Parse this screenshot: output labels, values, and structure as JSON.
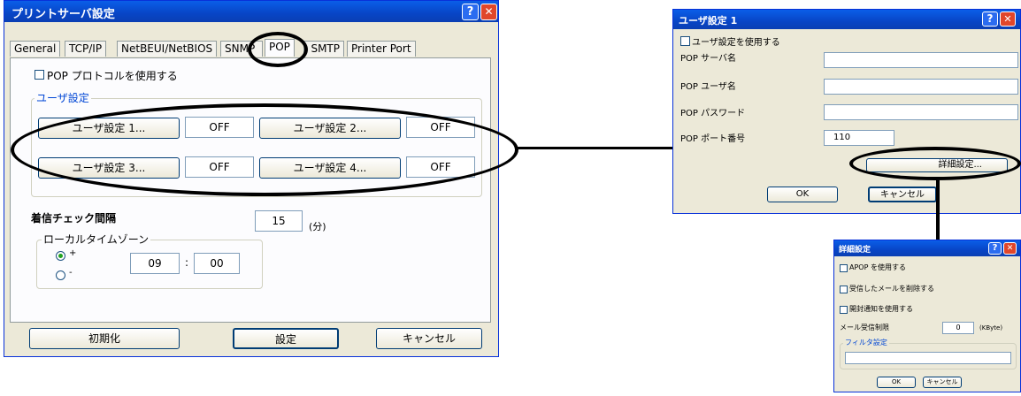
{
  "main": {
    "title": "プリントサーバ設定",
    "help": "?",
    "close": "✕",
    "tabs": [
      "General",
      "TCP/IP",
      "NetBEUI/NetBIOS",
      "SNMP",
      "POP",
      "SMTP",
      "Printer Port"
    ],
    "active_tab": "POP",
    "use_pop_label": "POP プロトコルを使用する",
    "user_group_label": "ユーザ設定",
    "user_buttons": [
      "ユーザ設定 1...",
      "ユーザ設定 2...",
      "ユーザ設定 3...",
      "ユーザ設定 4..."
    ],
    "user_status": [
      "OFF",
      "OFF",
      "OFF",
      "OFF"
    ],
    "interval_label": "着信チェック間隔",
    "interval_value": "15",
    "interval_unit": "(分)",
    "timezone_label": "ローカルタイムゾーン",
    "tz_plus": "+",
    "tz_minus": "-",
    "tz_hour": "09",
    "tz_sep": ":",
    "tz_min": "00",
    "btn_init": "初期化",
    "btn_set": "設定",
    "btn_cancel": "キャンセル"
  },
  "user_dialog": {
    "title": "ユーザ設定 1",
    "help": "?",
    "close": "✕",
    "use_label": "ユーザ設定を使用する",
    "server_label": "POP サーバ名",
    "server_value": "",
    "user_label": "POP ユーザ名",
    "user_value": "",
    "password_label": "POP パスワード",
    "password_value": "",
    "port_label": "POP ポート番号",
    "port_value": "110",
    "detail_button": "詳細設定...",
    "ok": "OK",
    "cancel": "キャンセル"
  },
  "detail_dialog": {
    "title": "詳細設定",
    "help": "?",
    "close": "✕",
    "apop_label": "APOP を使用する",
    "delete_label": "受信したメールを削除する",
    "notify_label": "開封通知を使用する",
    "limit_label": "メール受信制限",
    "limit_value": "0",
    "limit_unit": "(KByte)",
    "filter_label": "フィルタ設定",
    "filter_value": "",
    "ok": "OK",
    "cancel": "キャンセル"
  }
}
